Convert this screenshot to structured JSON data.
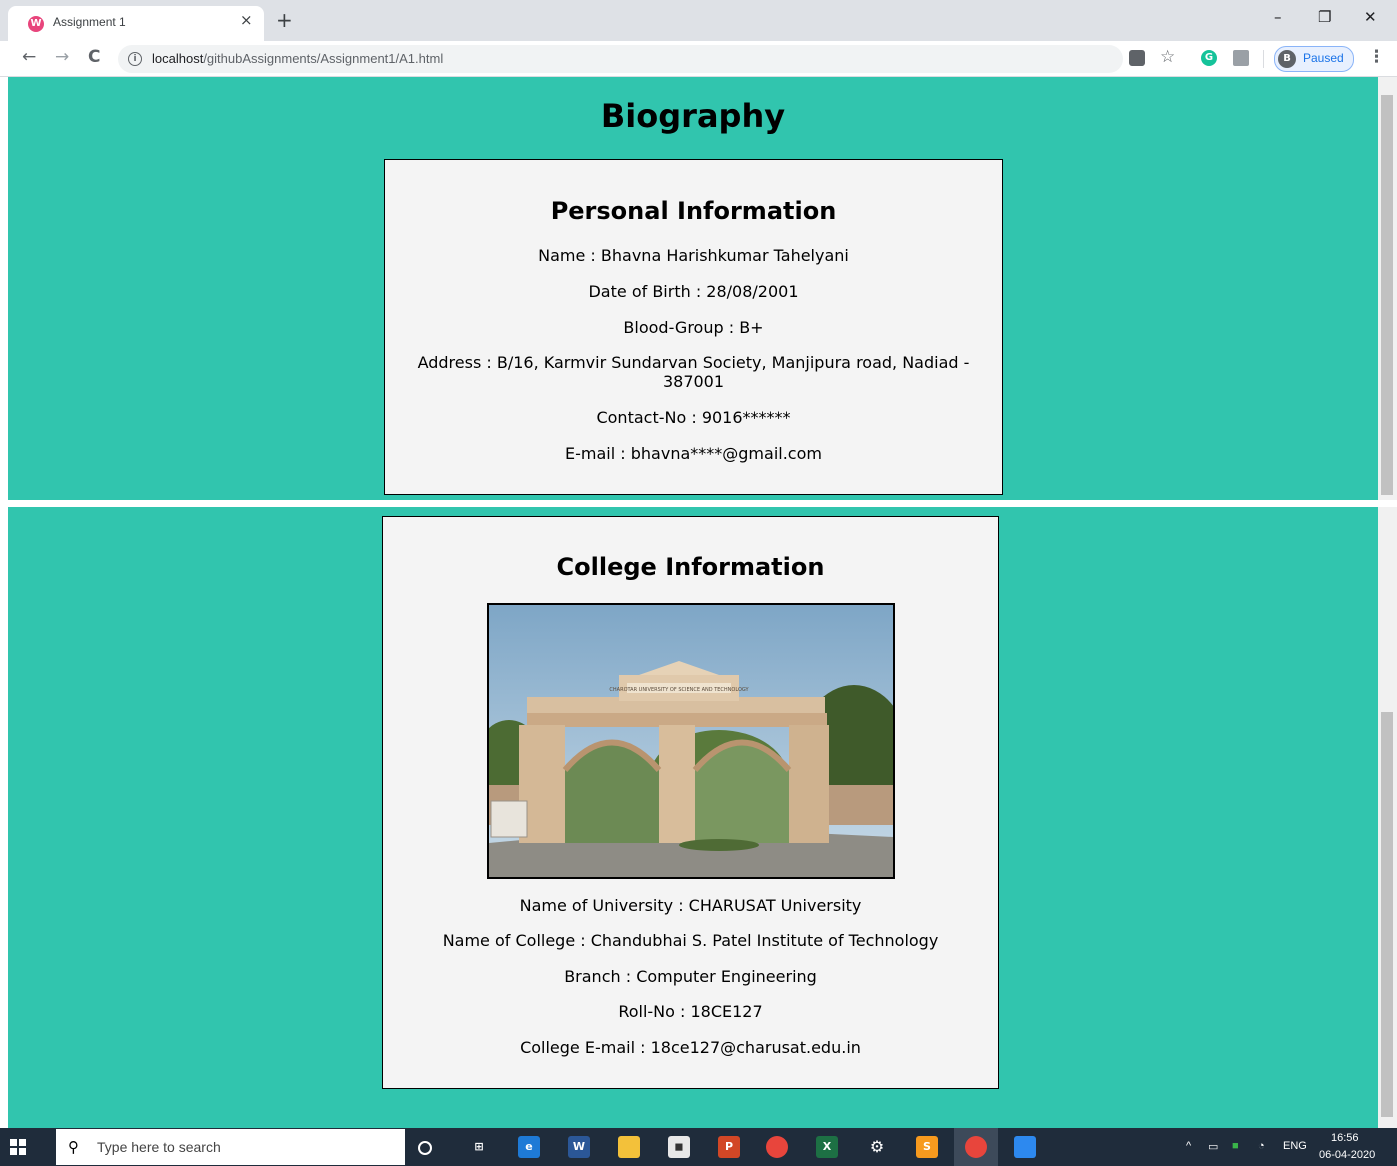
{
  "browser": {
    "tab_title": "Assignment 1",
    "tab_close": "×",
    "new_tab": "+",
    "url_host": "localhost",
    "url_path": "/githubAssignments/Assignment1/A1.html",
    "profile_initial": "B",
    "profile_status": "Paused",
    "back": "←",
    "forward": "→",
    "reload": "C",
    "minimize": "–",
    "restore": "❐",
    "close": "✕"
  },
  "page": {
    "title": "Biography",
    "personal": {
      "heading": "Personal Information",
      "name": "Name : Bhavna Harishkumar Tahelyani",
      "dob": "Date of Birth : 28/08/2001",
      "blood": "Blood-Group : B+",
      "address": "Address : B/16, Karmvir Sundarvan Society, Manjipura road, Nadiad - 387001",
      "contact": "Contact-No : 9016******",
      "email": "E-mail : bhavna****@gmail.com"
    },
    "college": {
      "heading": "College Information",
      "gate_sign": "CHAROTAR UNIVERSITY OF SCIENCE AND TECHNOLOGY",
      "university": "Name of University : CHARUSAT University",
      "college": "Name of College : Chandubhai S. Patel Institute of Technology",
      "branch": "Branch : Computer Engineering",
      "roll": "Roll-No : 18CE127",
      "email": "College E-mail : 18ce127@charusat.edu.in"
    }
  },
  "taskbar": {
    "search_placeholder": "Type here to search",
    "language": "ENG",
    "time": "16:56",
    "date": "06-04-2020"
  },
  "colors": {
    "page_background": "#31c5ae",
    "card_background": "#f4f4f4"
  }
}
